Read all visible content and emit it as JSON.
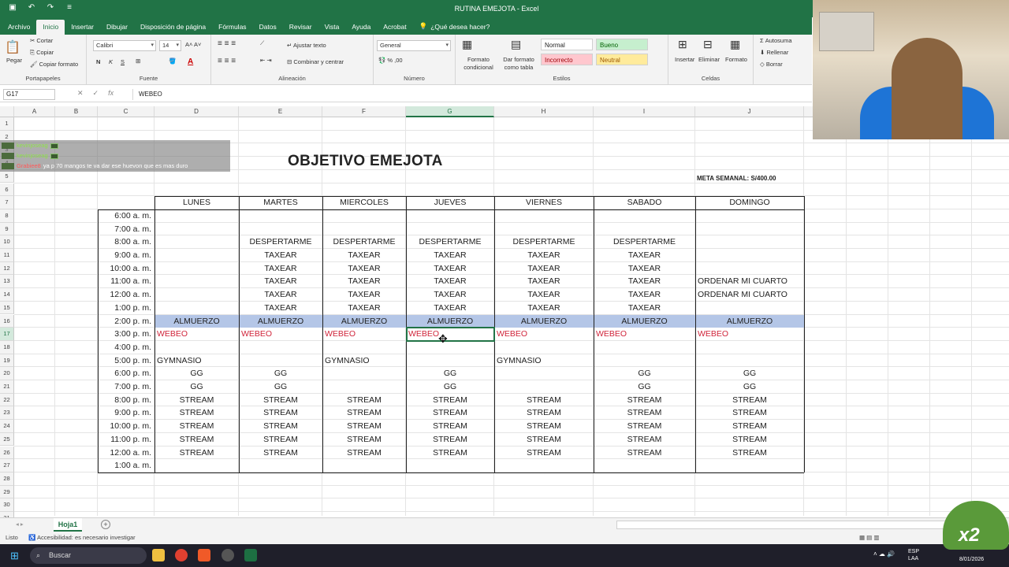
{
  "titlebar": {
    "title": "RUTINA EMEJOTA  -  Excel"
  },
  "tabs": [
    "Archivo",
    "Inicio",
    "Insertar",
    "Dibujar",
    "Disposición de página",
    "Fórmulas",
    "Datos",
    "Revisar",
    "Vista",
    "Ayuda",
    "Acrobat"
  ],
  "tell_me": "¿Qué desea hacer?",
  "ribbon": {
    "clipboard": {
      "paste": "Pegar",
      "cut": "Cortar",
      "copy": "Copiar",
      "format_painter": "Copiar formato",
      "label": "Portapapeles"
    },
    "font": {
      "name": "Calibri",
      "size": "14",
      "label": "Fuente",
      "bold": "N",
      "italic": "K",
      "underline": "S"
    },
    "alignment": {
      "wrap": "Ajustar texto",
      "merge": "Combinar y centrar",
      "label": "Alineación"
    },
    "number": {
      "format": "General",
      "label": "Número"
    },
    "styles": {
      "conditional": "Formato condicional",
      "table": "Dar formato como tabla",
      "normal": "Normal",
      "good": "Bueno",
      "bad": "Incorrecto",
      "neutral": "Neutral",
      "label": "Estilos"
    },
    "cells": {
      "insert": "Insertar",
      "delete": "Eliminar",
      "format": "Formato",
      "label": "Celdas"
    },
    "editing": {
      "autosum": "Autosuma",
      "fill": "Rellenar",
      "clear": "Borrar"
    }
  },
  "formula_bar": {
    "name_box": "G17",
    "content": "WEBEO"
  },
  "columns": [
    "A",
    "B",
    "C",
    "D",
    "E",
    "F",
    "G",
    "H",
    "I",
    "J"
  ],
  "rows": [
    "1",
    "2",
    "3",
    "4",
    "5",
    "6",
    "7",
    "8",
    "9",
    "10",
    "11",
    "12",
    "13",
    "14",
    "15",
    "16",
    "17",
    "18",
    "19",
    "20",
    "21",
    "22",
    "23",
    "24",
    "25",
    "26",
    "27",
    "28",
    "29",
    "30",
    "31"
  ],
  "chat": [
    {
      "user": "kevinjoseag",
      "msg": ""
    },
    {
      "user": "kevinjoseag",
      "msg": ""
    },
    {
      "user": "Grabiee8",
      "msg": "ya p 70 mangos te va dar ese huevon que es mas duro"
    }
  ],
  "sheet_title": "OBJETIVO EMEJOTA",
  "meta": "META SEMANAL: S/400.00",
  "days": [
    "LUNES",
    "MARTES",
    "MIERCOLES",
    "JUEVES",
    "VIERNES",
    "SABADO",
    "DOMINGO"
  ],
  "schedule": [
    {
      "time": "6:00 a. m.",
      "cells": [
        "",
        "",
        "",
        "",
        "",
        "",
        ""
      ]
    },
    {
      "time": "7:00 a. m.",
      "cells": [
        "",
        "",
        "",
        "",
        "",
        "",
        ""
      ]
    },
    {
      "time": "8:00 a. m.",
      "cells": [
        "",
        "DESPERTARME",
        "DESPERTARME",
        "DESPERTARME",
        "DESPERTARME",
        "DESPERTARME",
        ""
      ]
    },
    {
      "time": "9:00 a. m.",
      "cells": [
        "",
        "TAXEAR",
        "TAXEAR",
        "TAXEAR",
        "TAXEAR",
        "TAXEAR",
        ""
      ]
    },
    {
      "time": "10:00 a. m.",
      "cells": [
        "",
        "TAXEAR",
        "TAXEAR",
        "TAXEAR",
        "TAXEAR",
        "TAXEAR",
        ""
      ]
    },
    {
      "time": "11:00 a. m.",
      "cells": [
        "",
        "TAXEAR",
        "TAXEAR",
        "TAXEAR",
        "TAXEAR",
        "TAXEAR",
        "ORDENAR MI CUARTO"
      ]
    },
    {
      "time": "12:00 a. m.",
      "cells": [
        "",
        "TAXEAR",
        "TAXEAR",
        "TAXEAR",
        "TAXEAR",
        "TAXEAR",
        "ORDENAR MI CUARTO"
      ]
    },
    {
      "time": "1:00 p. m.",
      "cells": [
        "",
        "TAXEAR",
        "TAXEAR",
        "TAXEAR",
        "TAXEAR",
        "TAXEAR",
        ""
      ]
    },
    {
      "time": "2:00 p. m.",
      "cells": [
        "ALMUERZO",
        "ALMUERZO",
        "ALMUERZO",
        "ALMUERZO",
        "ALMUERZO",
        "ALMUERZO",
        "ALMUERZO"
      ]
    },
    {
      "time": "3:00 p. m.",
      "cells": [
        "WEBEO",
        "WEBEO",
        "WEBEO",
        "WEBEO",
        "WEBEO",
        "WEBEO",
        "WEBEO"
      ]
    },
    {
      "time": "4:00 p. m.",
      "cells": [
        "",
        "",
        "",
        "",
        "",
        "",
        ""
      ]
    },
    {
      "time": "5:00 p. m.",
      "cells": [
        "GYMNASIO",
        "",
        "GYMNASIO",
        "",
        "GYMNASIO",
        "",
        ""
      ]
    },
    {
      "time": "6:00 p. m.",
      "cells": [
        "GG",
        "GG",
        "",
        "GG",
        "",
        "GG",
        "GG"
      ]
    },
    {
      "time": "7:00 p. m.",
      "cells": [
        "GG",
        "GG",
        "",
        "GG",
        "",
        "GG",
        "GG"
      ]
    },
    {
      "time": "8:00 p. m.",
      "cells": [
        "STREAM",
        "STREAM",
        "STREAM",
        "STREAM",
        "STREAM",
        "STREAM",
        "STREAM"
      ]
    },
    {
      "time": "9:00 p. m.",
      "cells": [
        "STREAM",
        "STREAM",
        "STREAM",
        "STREAM",
        "STREAM",
        "STREAM",
        "STREAM"
      ]
    },
    {
      "time": "10:00 p. m.",
      "cells": [
        "STREAM",
        "STREAM",
        "STREAM",
        "STREAM",
        "STREAM",
        "STREAM",
        "STREAM"
      ]
    },
    {
      "time": "11:00 p. m.",
      "cells": [
        "STREAM",
        "STREAM",
        "STREAM",
        "STREAM",
        "STREAM",
        "STREAM",
        "STREAM"
      ]
    },
    {
      "time": "12:00 a. m.",
      "cells": [
        "STREAM",
        "STREAM",
        "STREAM",
        "STREAM",
        "STREAM",
        "STREAM",
        "STREAM"
      ]
    },
    {
      "time": "1:00 a. m.",
      "cells": [
        "",
        "",
        "",
        "",
        "",
        "",
        ""
      ]
    }
  ],
  "sheet_tab": "Hoja1",
  "status": {
    "ready": "Listo",
    "accessibility": "Accesibilidad: es necesario investigar"
  },
  "taskbar": {
    "search": "Buscar",
    "lang": "ESP",
    "lang2": "LAA",
    "date": "8/01/2026"
  },
  "overlay": {
    "badge": "x2"
  },
  "colors": {
    "excel_green": "#217346",
    "lunch_fill": "#b4c6e7",
    "webeo_red": "#d0253b"
  },
  "icons": [
    "save-icon",
    "undo-icon",
    "redo-icon",
    "lightbulb-icon",
    "search-icon",
    "windows-icon",
    "folder-icon",
    "chrome-icon",
    "brave-icon",
    "excel-icon"
  ]
}
